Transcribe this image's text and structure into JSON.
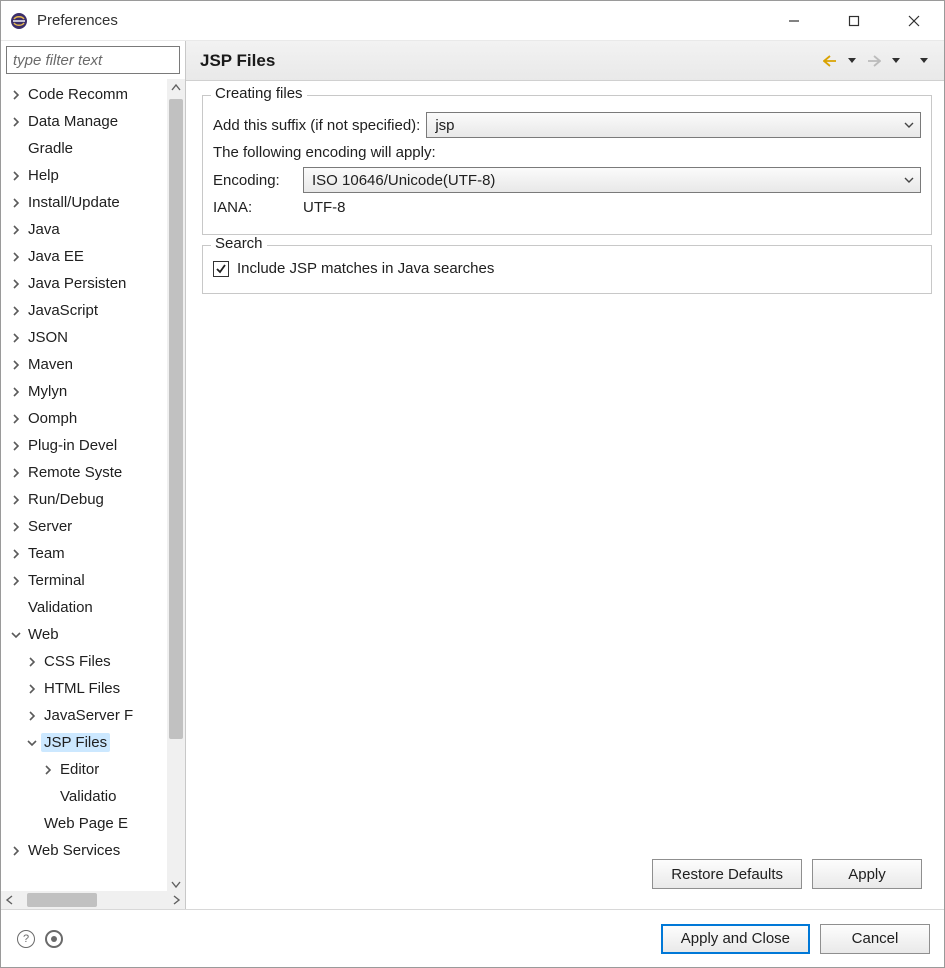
{
  "window": {
    "title": "Preferences"
  },
  "filter": {
    "placeholder": "type filter text"
  },
  "tree": [
    {
      "label": "Code Recomm",
      "expandable": true,
      "expanded": false,
      "depth": 0
    },
    {
      "label": "Data Manage",
      "expandable": true,
      "expanded": false,
      "depth": 0
    },
    {
      "label": "Gradle",
      "expandable": false,
      "expanded": false,
      "depth": 0
    },
    {
      "label": "Help",
      "expandable": true,
      "expanded": false,
      "depth": 0
    },
    {
      "label": "Install/Update",
      "expandable": true,
      "expanded": false,
      "depth": 0
    },
    {
      "label": "Java",
      "expandable": true,
      "expanded": false,
      "depth": 0
    },
    {
      "label": "Java EE",
      "expandable": true,
      "expanded": false,
      "depth": 0
    },
    {
      "label": "Java Persisten",
      "expandable": true,
      "expanded": false,
      "depth": 0
    },
    {
      "label": "JavaScript",
      "expandable": true,
      "expanded": false,
      "depth": 0
    },
    {
      "label": "JSON",
      "expandable": true,
      "expanded": false,
      "depth": 0
    },
    {
      "label": "Maven",
      "expandable": true,
      "expanded": false,
      "depth": 0
    },
    {
      "label": "Mylyn",
      "expandable": true,
      "expanded": false,
      "depth": 0
    },
    {
      "label": "Oomph",
      "expandable": true,
      "expanded": false,
      "depth": 0
    },
    {
      "label": "Plug-in Devel",
      "expandable": true,
      "expanded": false,
      "depth": 0
    },
    {
      "label": "Remote Syste",
      "expandable": true,
      "expanded": false,
      "depth": 0
    },
    {
      "label": "Run/Debug",
      "expandable": true,
      "expanded": false,
      "depth": 0
    },
    {
      "label": "Server",
      "expandable": true,
      "expanded": false,
      "depth": 0
    },
    {
      "label": "Team",
      "expandable": true,
      "expanded": false,
      "depth": 0
    },
    {
      "label": "Terminal",
      "expandable": true,
      "expanded": false,
      "depth": 0
    },
    {
      "label": "Validation",
      "expandable": false,
      "expanded": false,
      "depth": 0
    },
    {
      "label": "Web",
      "expandable": true,
      "expanded": true,
      "depth": 0
    },
    {
      "label": "CSS Files",
      "expandable": true,
      "expanded": false,
      "depth": 1
    },
    {
      "label": "HTML Files",
      "expandable": true,
      "expanded": false,
      "depth": 1
    },
    {
      "label": "JavaServer F",
      "expandable": true,
      "expanded": false,
      "depth": 1
    },
    {
      "label": "JSP Files",
      "expandable": true,
      "expanded": true,
      "depth": 1,
      "selected": true
    },
    {
      "label": "Editor",
      "expandable": true,
      "expanded": false,
      "depth": 2
    },
    {
      "label": "Validatio",
      "expandable": false,
      "expanded": false,
      "depth": 2
    },
    {
      "label": "Web Page E",
      "expandable": false,
      "expanded": false,
      "depth": 1
    },
    {
      "label": "Web Services",
      "expandable": true,
      "expanded": false,
      "depth": 0
    }
  ],
  "page": {
    "title": "JSP Files",
    "groups": {
      "creating": {
        "title": "Creating files",
        "suffix_label": "Add this suffix (if not specified):",
        "suffix_value": "jsp",
        "encoding_note": "The following encoding will apply:",
        "encoding_label": "Encoding:",
        "encoding_value": "ISO 10646/Unicode(UTF-8)",
        "iana_label": "IANA:",
        "iana_value": "UTF-8"
      },
      "search": {
        "title": "Search",
        "include_label": "Include JSP matches in Java searches",
        "include_checked": true
      }
    }
  },
  "buttons": {
    "restore_defaults": "Restore Defaults",
    "apply": "Apply",
    "apply_close": "Apply and Close",
    "cancel": "Cancel"
  }
}
